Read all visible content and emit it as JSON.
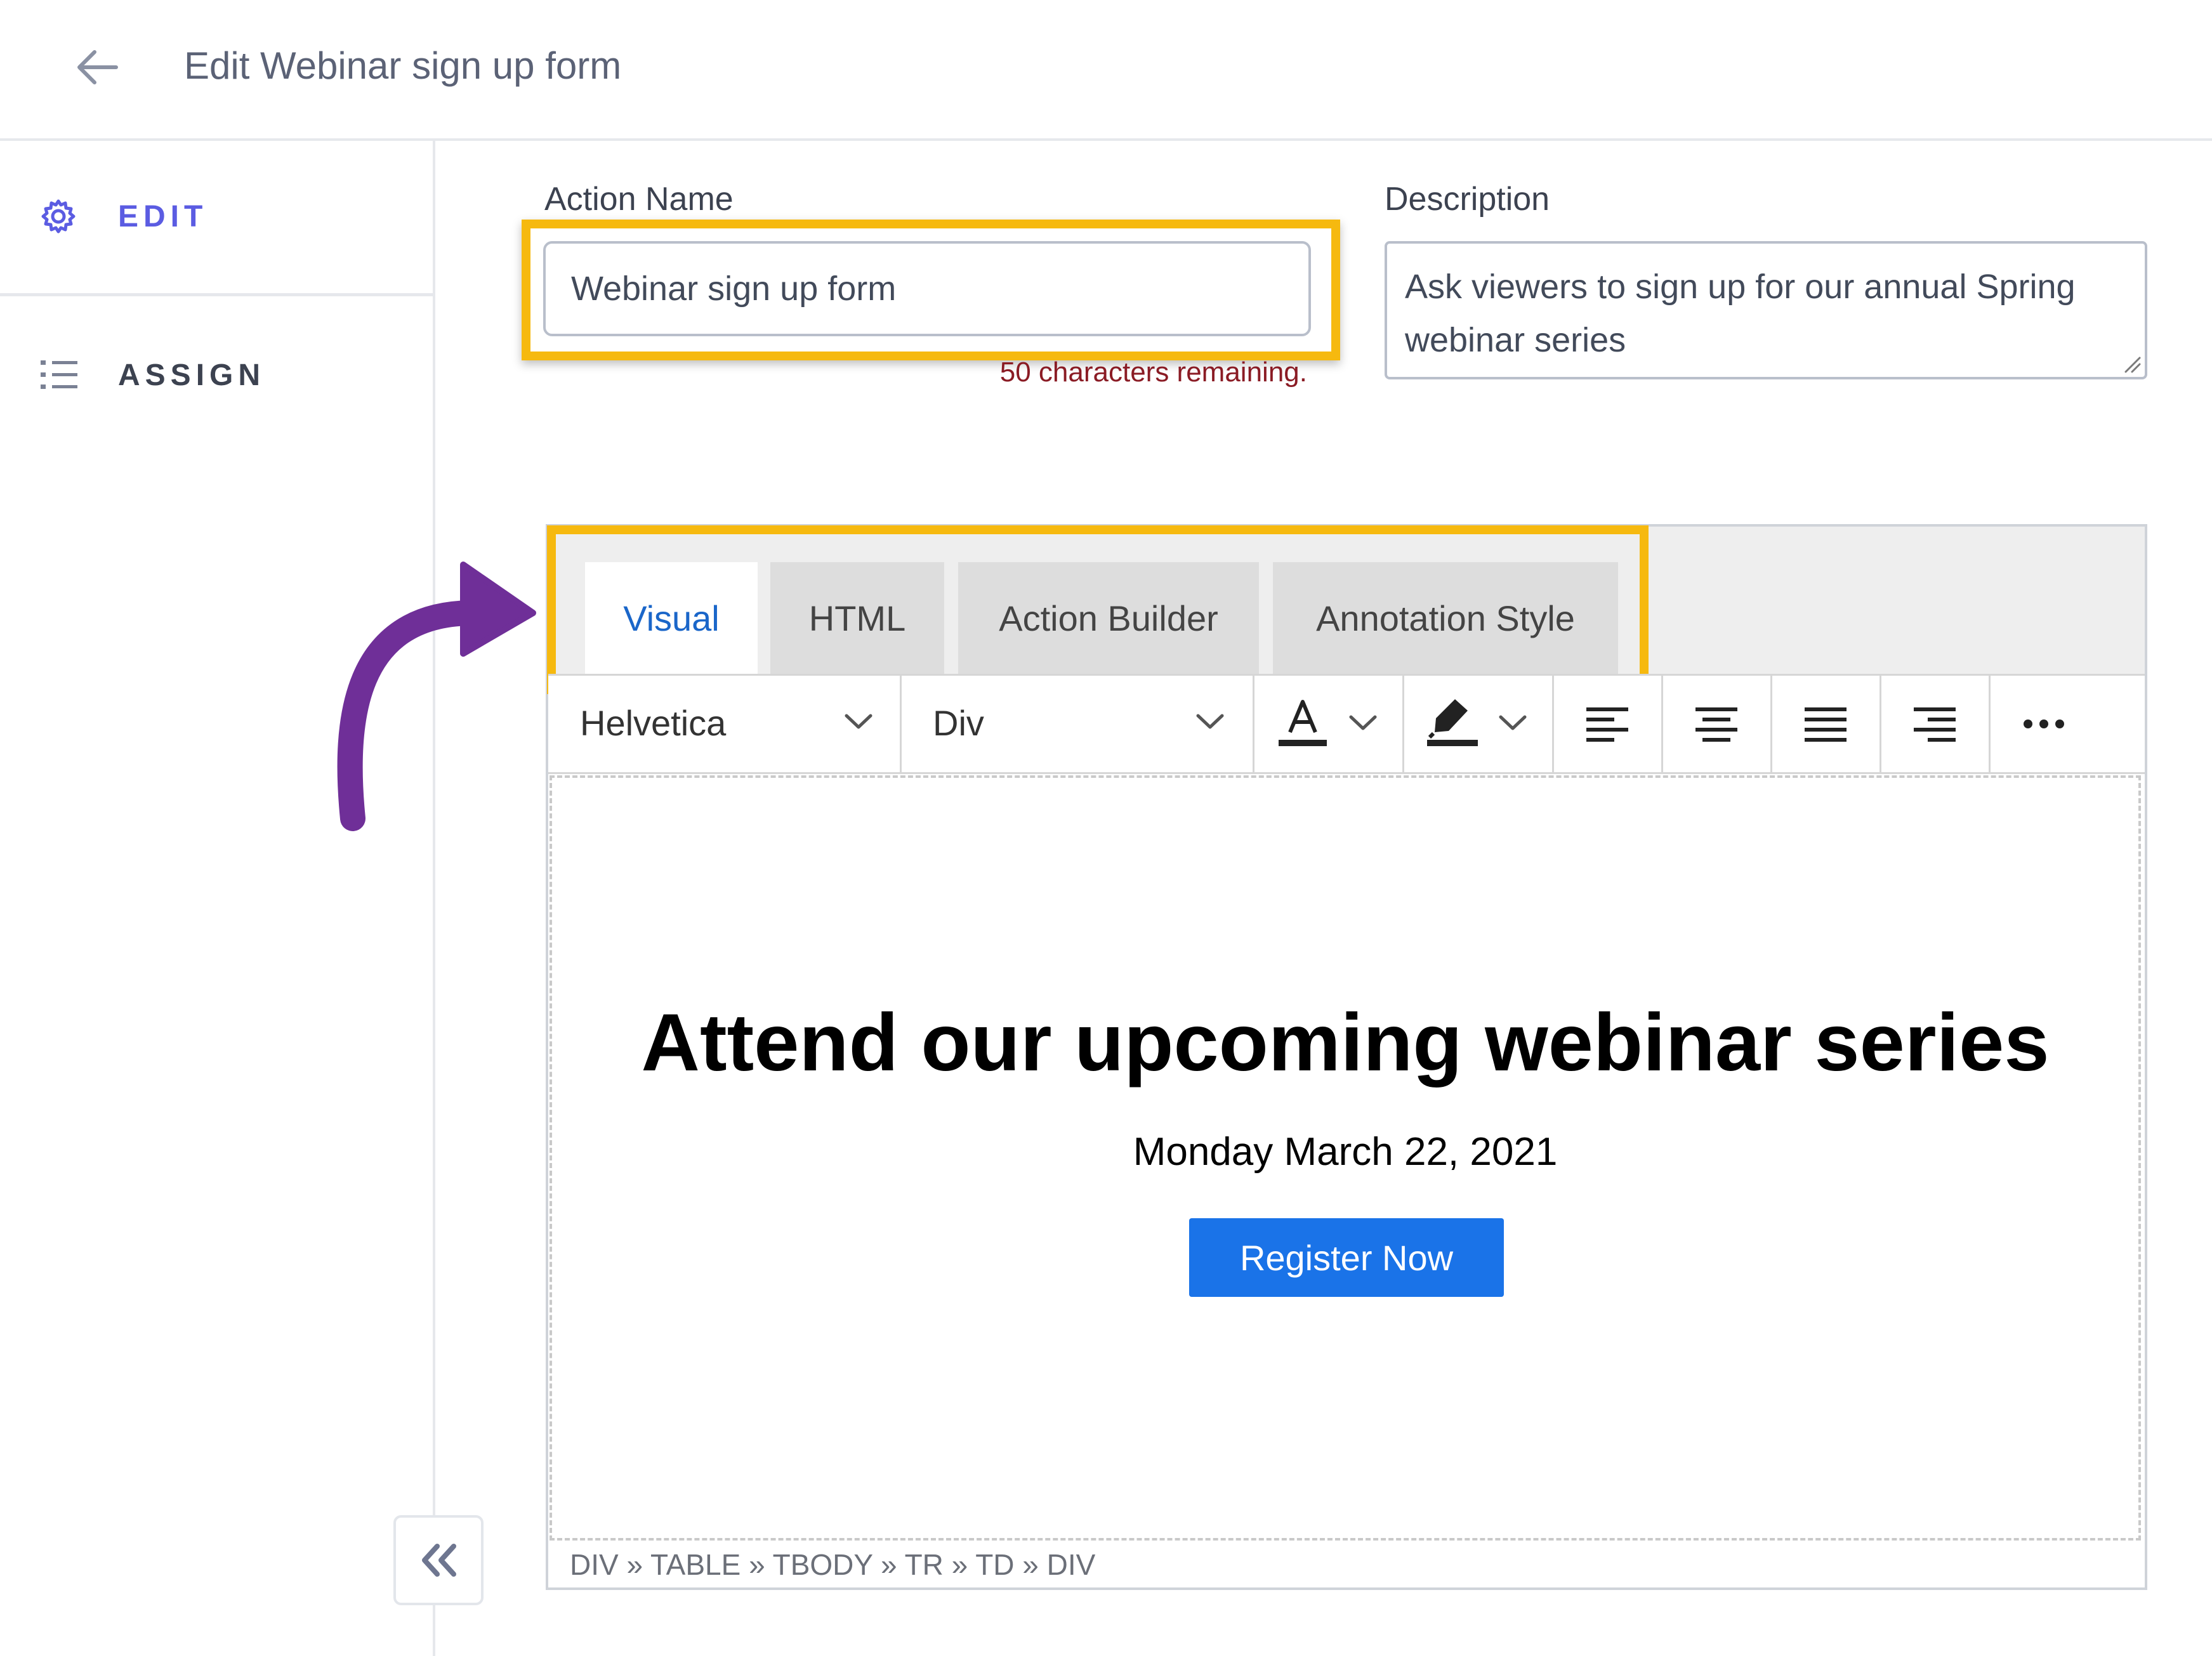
{
  "header": {
    "title": "Edit Webinar sign up form",
    "back_icon": "arrow-left-icon"
  },
  "sidebar": {
    "items": [
      {
        "label": "EDIT",
        "icon": "gear-icon",
        "color": "#5b5ce2"
      },
      {
        "label": "ASSIGN",
        "icon": "list-icon",
        "color": "#3c4250"
      }
    ],
    "collapse_icon": "double-chevron-left-icon"
  },
  "form": {
    "action_name_label": "Action Name",
    "action_name_value": "Webinar sign up form",
    "char_counter": "50 characters remaining.",
    "description_label": "Description",
    "description_value": "Ask viewers to sign up for our annual Spring webinar series"
  },
  "editor": {
    "tabs": [
      {
        "label": "Visual",
        "active": true
      },
      {
        "label": "HTML",
        "active": false
      },
      {
        "label": "Action Builder",
        "active": false
      },
      {
        "label": "Annotation Style",
        "active": false
      }
    ],
    "toolbar": {
      "font_select": "Helvetica",
      "block_select": "Div",
      "icons": [
        "text-color-icon",
        "highlight-icon",
        "align-left-icon",
        "align-center-icon",
        "align-justify-icon",
        "align-right-icon",
        "more-icon"
      ]
    },
    "content": {
      "headline": "Attend our upcoming webinar series",
      "date": "Monday March 22, 2021",
      "button_label": "Register Now"
    },
    "status_path": "DIV » TABLE » TBODY » TR » TD » DIV"
  },
  "colors": {
    "highlight": "#f6b90f",
    "annotation_arrow": "#6f2f98",
    "primary_button": "#1a73e8",
    "active_tab_text": "#1a66c9"
  }
}
